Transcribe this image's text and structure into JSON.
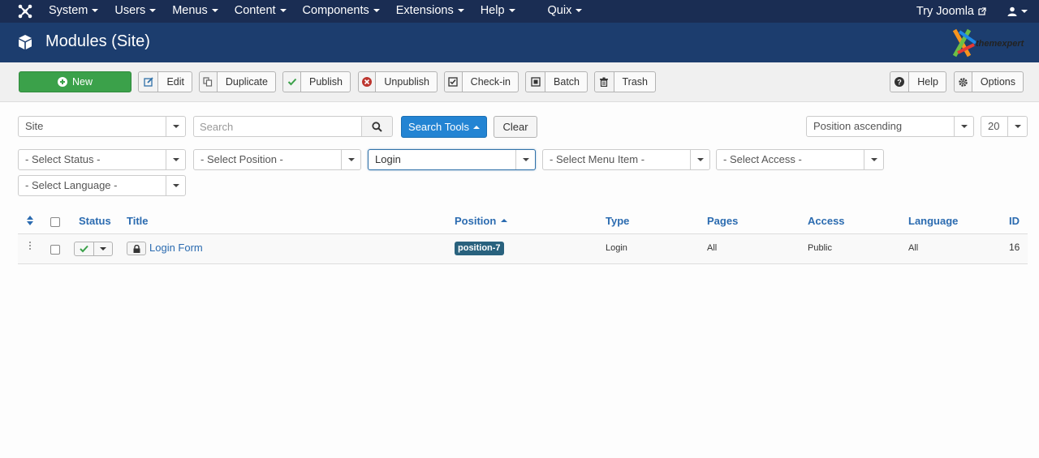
{
  "navbar": {
    "menu": [
      {
        "label": "System"
      },
      {
        "label": "Users"
      },
      {
        "label": "Menus"
      },
      {
        "label": "Content"
      },
      {
        "label": "Components"
      },
      {
        "label": "Extensions"
      },
      {
        "label": "Help"
      },
      {
        "label": "Quix"
      }
    ],
    "try_joomla": "Try Joomla"
  },
  "header": {
    "title": "Modules (Site)"
  },
  "toolbar": {
    "new": "New",
    "edit": "Edit",
    "duplicate": "Duplicate",
    "publish": "Publish",
    "unpublish": "Unpublish",
    "checkin": "Check-in",
    "batch": "Batch",
    "trash": "Trash",
    "help": "Help",
    "options": "Options"
  },
  "filters": {
    "client": "Site",
    "search_placeholder": "Search",
    "search_tools": "Search Tools",
    "clear": "Clear",
    "ordering": "Position ascending",
    "limit": "20",
    "status": "- Select Status -",
    "position": "- Select Position -",
    "module": "Login",
    "menu_item": "- Select Menu Item -",
    "access": "- Select Access -",
    "language": "- Select Language -"
  },
  "table": {
    "headers": {
      "status": "Status",
      "title": "Title",
      "position": "Position",
      "type": "Type",
      "pages": "Pages",
      "access": "Access",
      "language": "Language",
      "id": "ID"
    },
    "rows": [
      {
        "title": "Login Form",
        "position": "position-7",
        "type": "Login",
        "pages": "All",
        "access": "Public",
        "language": "All",
        "id": "16"
      }
    ]
  },
  "colors": {
    "navbar": "#1a2d53",
    "header": "#1c3d6e",
    "new_button": "#3ba14a",
    "search_tools_button": "#2384d3",
    "link": "#2b6bb0",
    "position_badge": "#29627e"
  }
}
